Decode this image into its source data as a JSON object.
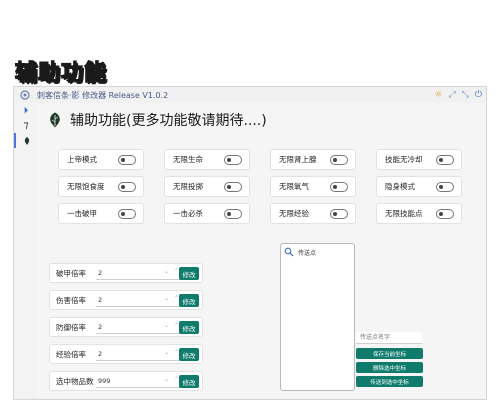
{
  "banner": {
    "text": "辅助功能"
  },
  "window": {
    "title": "刺客信条·影 修改器 Release V1.0.2",
    "controls": {
      "theme": "☼",
      "pin": "⤢",
      "minimize": "⤡",
      "close": "⏻"
    }
  },
  "sidebar": {
    "items": [
      {
        "icon": "play-forward-icon",
        "glyph": "⏵"
      },
      {
        "icon": "wrench-icon",
        "glyph": "⁊"
      },
      {
        "icon": "leaf-icon"
      }
    ]
  },
  "page": {
    "title": "辅助功能(更多功能敬请期待....)"
  },
  "toggles": [
    {
      "label": "上帝模式",
      "on": false
    },
    {
      "label": "无限生命",
      "on": false
    },
    {
      "label": "无限肾上腺",
      "on": false
    },
    {
      "label": "技能无冷却",
      "on": false
    },
    {
      "label": "无限饱食度",
      "on": false
    },
    {
      "label": "无限投掷",
      "on": false
    },
    {
      "label": "无限氧气",
      "on": false
    },
    {
      "label": "隐身模式",
      "on": false
    },
    {
      "label": "一击破甲",
      "on": false
    },
    {
      "label": "一击必杀",
      "on": false
    },
    {
      "label": "无限经验",
      "on": false
    },
    {
      "label": "无限技能点",
      "on": false
    }
  ],
  "fields": [
    {
      "label": "破甲倍率",
      "value": "2",
      "button": "修改"
    },
    {
      "label": "伤害倍率",
      "value": "2",
      "button": "修改"
    },
    {
      "label": "防御倍率",
      "value": "2",
      "button": "修改"
    },
    {
      "label": "经验倍率",
      "value": "2",
      "button": "修改"
    },
    {
      "label": "选中物品数",
      "value": "999",
      "button": "修改"
    }
  ],
  "teleport": {
    "title": "传送点",
    "name_placeholder": "传送点名字",
    "save_button": "保存当前坐标",
    "delete_button": "删除选中坐标",
    "teleport_button": "传送到选中坐标"
  },
  "colors": {
    "accent": "#0f7b6c",
    "banner": "#f6d21d",
    "title_blue": "#4b5a8a"
  }
}
